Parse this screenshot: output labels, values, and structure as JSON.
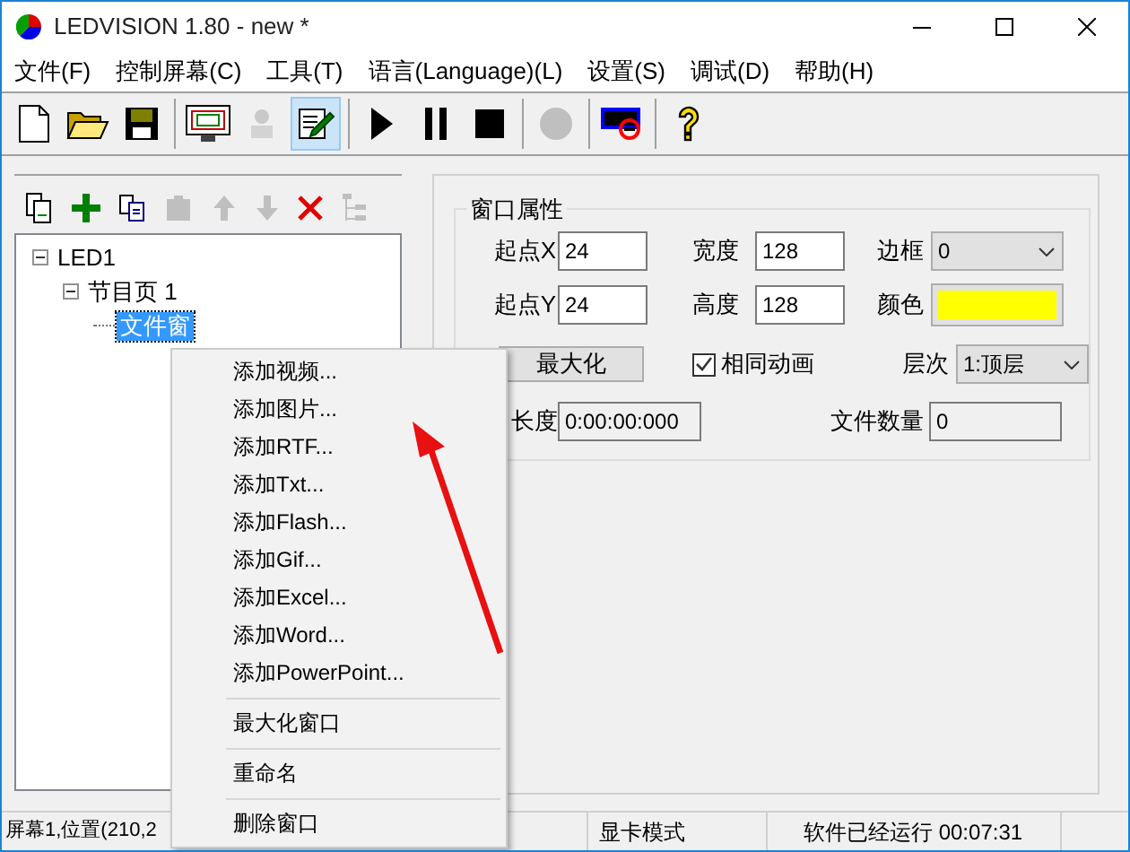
{
  "window": {
    "title": "LEDVISION 1.80 - new *"
  },
  "menu_bar": [
    "文件(F)",
    "控制屏幕(C)",
    "工具(T)",
    "语言(Language)(L)",
    "设置(S)",
    "调试(D)",
    "帮助(H)"
  ],
  "toolbar": [
    [
      {
        "kind": "new",
        "pressed": false,
        "disabled": false
      },
      {
        "kind": "open",
        "pressed": false,
        "disabled": false
      },
      {
        "kind": "save",
        "pressed": false,
        "disabled": false
      }
    ],
    [
      {
        "kind": "monitor",
        "pressed": false,
        "disabled": false
      },
      {
        "kind": "connect",
        "pressed": false,
        "disabled": true
      },
      {
        "kind": "edit",
        "pressed": true,
        "disabled": false
      }
    ],
    [
      {
        "kind": "play",
        "pressed": false,
        "disabled": false
      },
      {
        "kind": "pause",
        "pressed": false,
        "disabled": false
      },
      {
        "kind": "stop",
        "pressed": false,
        "disabled": false
      }
    ],
    [
      {
        "kind": "record",
        "pressed": false,
        "disabled": true
      }
    ],
    [
      {
        "kind": "screen_off",
        "pressed": false,
        "disabled": false
      }
    ],
    [
      {
        "kind": "help",
        "pressed": false,
        "disabled": false
      }
    ]
  ],
  "tree_toolbar": [
    {
      "kind": "pages",
      "disabled": false
    },
    {
      "kind": "add",
      "disabled": false
    },
    {
      "kind": "copy",
      "disabled": false
    },
    {
      "kind": "paste",
      "disabled": true
    },
    {
      "kind": "up",
      "disabled": true
    },
    {
      "kind": "down",
      "disabled": true
    },
    {
      "kind": "delete",
      "disabled": false
    },
    {
      "kind": "tree",
      "disabled": true
    }
  ],
  "tree": [
    {
      "label": "LED1",
      "expanded": true,
      "selected": false,
      "children": [
        {
          "label": "节目页 1",
          "expanded": true,
          "selected": false,
          "children": [
            {
              "label": "文件窗",
              "selected": true
            }
          ]
        }
      ]
    }
  ],
  "window_properties": {
    "title": "窗口属性",
    "start_x": {
      "label": "起点X",
      "value": "24"
    },
    "width": {
      "label": "宽度",
      "value": "128"
    },
    "border": {
      "label": "边框",
      "value": "0"
    },
    "start_y": {
      "label": "起点Y",
      "value": "24"
    },
    "height": {
      "label": "高度",
      "value": "128"
    },
    "color": {
      "label": "颜色",
      "color": "#ffff00"
    },
    "maximize_button": "最大化",
    "same_animation": {
      "label": "相同动画",
      "checked": true
    },
    "layer": {
      "label": "层次",
      "value": "1:顶层"
    },
    "length": {
      "label": "长度",
      "value": "0:00:00:000"
    },
    "file_count": {
      "label": "文件数量",
      "value": "0"
    }
  },
  "context_menu": [
    [
      "添加视频...",
      "添加图片...",
      "添加RTF...",
      "添加Txt...",
      "添加Flash...",
      "添加Gif...",
      "添加Excel...",
      "添加Word...",
      "添加PowerPoint..."
    ],
    [
      "最大化窗口"
    ],
    [
      "重命名"
    ],
    [
      "删除窗口"
    ]
  ],
  "status_bar": [
    "屏幕1,位置(210,2",
    "显卡模式",
    "软件已经运行 00:07:31"
  ]
}
